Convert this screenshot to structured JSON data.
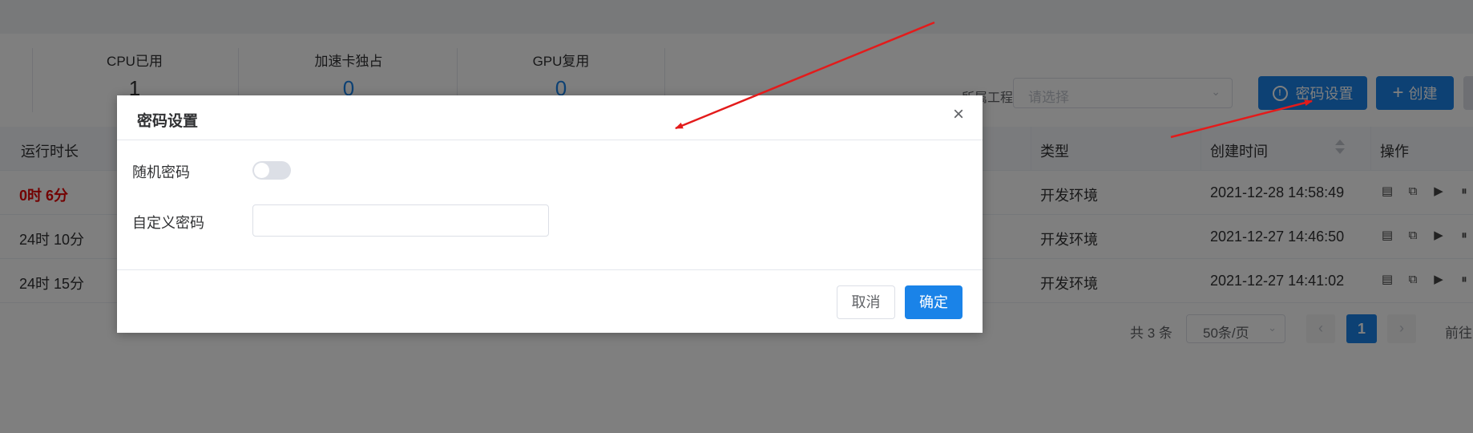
{
  "stats": [
    {
      "label": "CPU已用",
      "value": "1"
    },
    {
      "label": "加速卡独占",
      "value": "0"
    },
    {
      "label": "GPU复用",
      "value": "0"
    }
  ],
  "filter": {
    "project_label": "所属工程",
    "project_placeholder": "请选择"
  },
  "toolbar": {
    "password_settings": "密码设置",
    "create": "创建"
  },
  "table": {
    "headers": {
      "runtime": "运行时长",
      "type": "类型",
      "created": "创建时间",
      "actions": "操作"
    },
    "rows": [
      {
        "runtime": "0时 6分",
        "type": "开发环境",
        "created": "2021-12-28 14:58:49",
        "highlight": true
      },
      {
        "runtime": "24时 10分",
        "type": "开发环境",
        "created": "2021-12-27 14:46:50",
        "highlight": false
      },
      {
        "runtime": "24时 15分",
        "type": "开发环境",
        "created": "2021-12-27 14:41:02",
        "highlight": false
      }
    ],
    "action_icons": [
      "terminal-icon",
      "copy-icon",
      "play-icon",
      "pause-icon"
    ]
  },
  "pagination": {
    "total": "共 3 条",
    "page_size": "50条/页",
    "current": "1",
    "goto": "前往"
  },
  "modal": {
    "title": "密码设置",
    "random_password_label": "随机密码",
    "random_password_enabled": false,
    "custom_password_label": "自定义密码",
    "custom_password_value": "",
    "cancel": "取消",
    "confirm": "确定"
  },
  "colors": {
    "primary": "#1a83e8",
    "highlight_text": "#e60000",
    "arrow": "#e31b1b"
  }
}
